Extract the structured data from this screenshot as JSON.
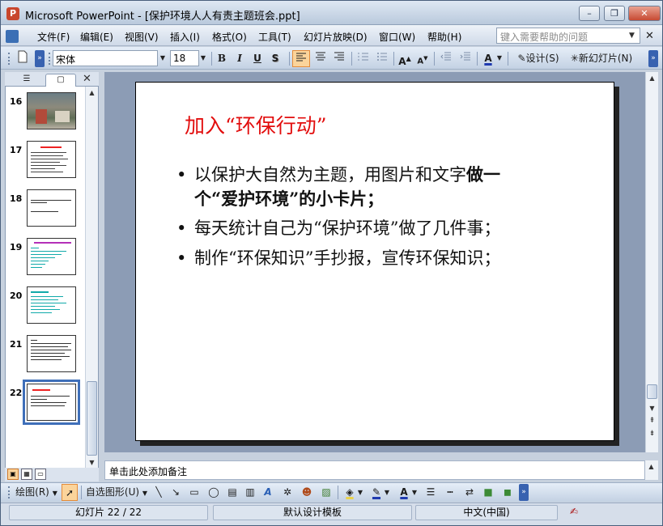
{
  "window": {
    "title": "Microsoft PowerPoint - [保护环境人人有责主题班会.ppt]",
    "minimize_symbol": "–",
    "maximize_symbol": "❐",
    "close_symbol": "✕"
  },
  "menubar": {
    "items": [
      "文件(F)",
      "编辑(E)",
      "视图(V)",
      "插入(I)",
      "格式(O)",
      "工具(T)",
      "幻灯片放映(D)",
      "窗口(W)",
      "帮助(H)"
    ],
    "help_placeholder": "键入需要帮助的问题"
  },
  "toolbar": {
    "font_name": "宋体",
    "font_size": "18",
    "bold": "B",
    "italic": "I",
    "underline": "U",
    "shadow": "S",
    "design_label": "设计(S)",
    "new_slide_label": "新幻灯片(N)"
  },
  "slides_panel": {
    "numbers": [
      "16",
      "17",
      "18",
      "19",
      "20",
      "21",
      "22"
    ],
    "selected": "22"
  },
  "slide": {
    "title": "加入“环保行动”",
    "bullet_char": "•",
    "bullets": [
      {
        "line1_plain": "以保护大自然为主题，用图片和文字",
        "line1_bold": "做一",
        "line2": "个“爱护环境”的小卡片；"
      },
      {
        "line1_plain": "每天统计自己为“保护环境”做了几件事；"
      },
      {
        "line1_plain": "制作“环保知识”手抄报，宣传环保知识；"
      }
    ]
  },
  "notes_placeholder": "单击此处添加备注",
  "drawbar": {
    "draw_label": "绘图(R)",
    "autoshapes_label": "自选图形(U)"
  },
  "statusbar": {
    "slide_info": "幻灯片 22 / 22",
    "template": "默认设计模板",
    "language": "中文(中国)"
  }
}
